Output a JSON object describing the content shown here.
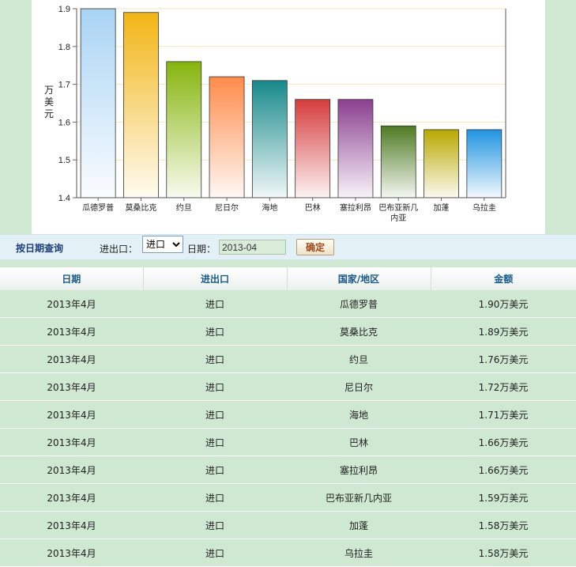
{
  "chart_data": {
    "type": "bar",
    "ylabel": "万美元",
    "ylim": [
      1.4,
      1.9
    ],
    "yticks": [
      1.4,
      1.5,
      1.6,
      1.7,
      1.8,
      1.9
    ],
    "categories": [
      "瓜德罗普",
      "莫桑比克",
      "约旦",
      "尼日尔",
      "海地",
      "巴林",
      "塞拉利昂",
      "巴布亚新几内亚",
      "加蓬",
      "乌拉圭"
    ],
    "values": [
      1.9,
      1.89,
      1.76,
      1.72,
      1.71,
      1.66,
      1.66,
      1.59,
      1.58,
      1.58
    ],
    "colors": [
      "#a9d4f4",
      "#f2b514",
      "#86b50c",
      "#ff8b4a",
      "#16898a",
      "#d63c3c",
      "#8a3f8f",
      "#4e7a22",
      "#b8a800",
      "#1f94e0"
    ],
    "grid": true
  },
  "query": {
    "title": "按日期查询",
    "ie_label": "进出口：",
    "ie_selected": "进口",
    "ie_options": [
      "进口"
    ],
    "date_label": "日期：",
    "date_value": "2013-04",
    "confirm_label": "确定"
  },
  "table": {
    "headers": [
      "日期",
      "进出口",
      "国家/地区",
      "金额"
    ],
    "rows": [
      [
        "2013年4月",
        "进口",
        "瓜德罗普",
        "1.90万美元"
      ],
      [
        "2013年4月",
        "进口",
        "莫桑比克",
        "1.89万美元"
      ],
      [
        "2013年4月",
        "进口",
        "约旦",
        "1.76万美元"
      ],
      [
        "2013年4月",
        "进口",
        "尼日尔",
        "1.72万美元"
      ],
      [
        "2013年4月",
        "进口",
        "海地",
        "1.71万美元"
      ],
      [
        "2013年4月",
        "进口",
        "巴林",
        "1.66万美元"
      ],
      [
        "2013年4月",
        "进口",
        "塞拉利昂",
        "1.66万美元"
      ],
      [
        "2013年4月",
        "进口",
        "巴布亚新几内亚",
        "1.59万美元"
      ],
      [
        "2013年4月",
        "进口",
        "加蓬",
        "1.58万美元"
      ],
      [
        "2013年4月",
        "进口",
        "乌拉圭",
        "1.58万美元"
      ]
    ]
  }
}
